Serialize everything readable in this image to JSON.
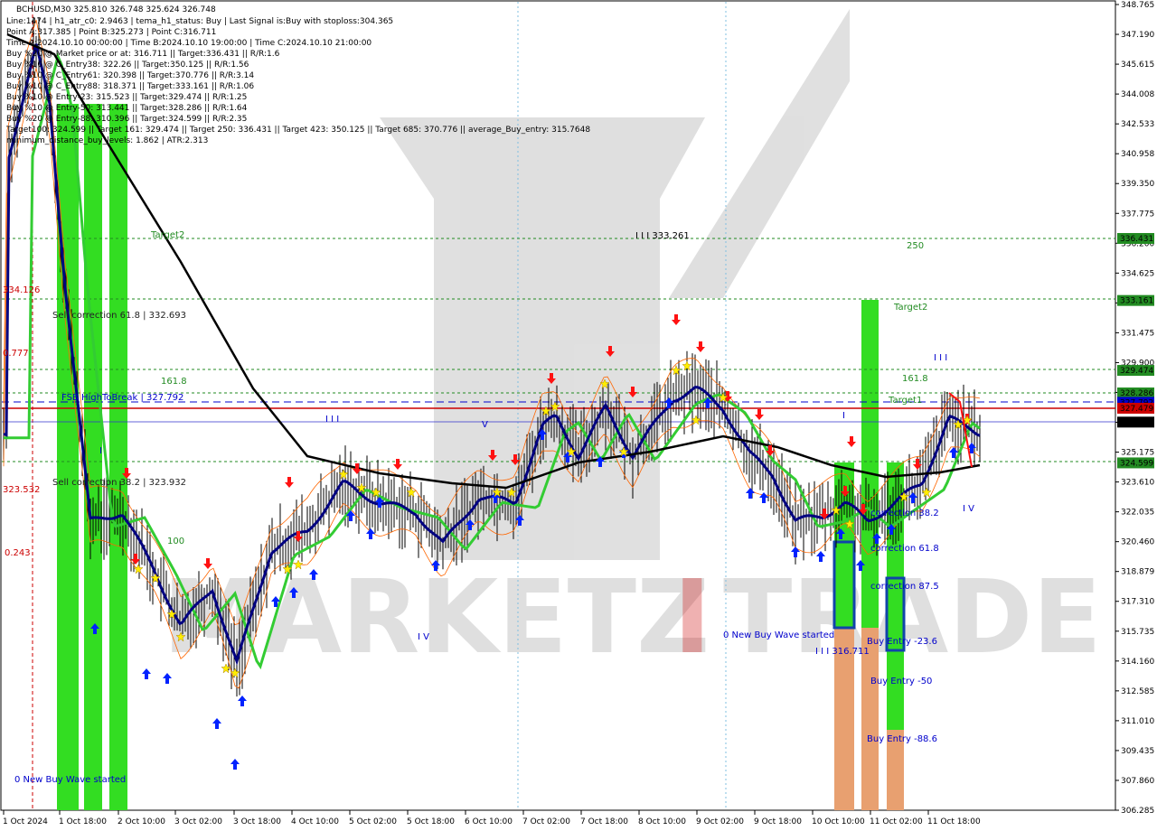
{
  "header": {
    "symbol_line": "BCHUSD,M30  325.810 326.748 325.624 326.748",
    "info_lines": [
      "Line:1474 | h1_atr_c0: 2.9463 | tema_h1_status: Buy | Last Signal is:Buy with stoploss:304.365",
      "Point A:317.385 | Point B:325.273 | Point C:316.711",
      "Time A:2024.10.10 00:00:00 | Time B:2024.10.10 19:00:00 | Time C:2024.10.10 21:00:00",
      "Buy %20 @ Market price or at: 316.711 || Target:336.431 || R/R:1.6",
      "Buy %10 @ C_Entry38: 322.26 || Target:350.125 || R/R:1.56",
      "Buy %10 @ C_Entry61: 320.398 || Target:370.776 || R/R:3.14",
      "Buy %10 @ C_Entry88: 318.371 || Target:333.161 || R/R:1.06",
      "Buy %10 @ Entry-23: 315.523 || Target:329.474 || R/R:1.25",
      "Buy %10 @ Entry-50: 313.441 || Target:328.286 || R/R:1.64",
      "Buy %20 @ Entry-88: 310.396 || Target:324.599 || R/R:2.35",
      "Target100: 324.599 || Target 161: 329.474 || Target 250: 336.431 || Target 423: 350.125 || Target 685: 370.776 || average_Buy_entry: 315.7648",
      "minimum_distance_buy_levels: 1.862 | ATR:2.313"
    ]
  },
  "watermark": {
    "text_dark": "MARKETZ",
    "text_red": "I",
    "text_gray": "TRADE"
  },
  "colors": {
    "candle": "#000000",
    "tema_blue": "#000080",
    "ma_green": "#33cc33",
    "ma_black": "#000000",
    "green_bar": "#33dd22",
    "orange_bar": "#e8a070",
    "level_green": "#228b22",
    "level_blue": "#0000cc",
    "level_red": "#cc0000",
    "arrow_blue": "#0022ff",
    "arrow_red": "#ff1111",
    "star": "#ffee00"
  },
  "price_axis": {
    "ticks": [
      "348.765",
      "347.190",
      "345.615",
      "344.008",
      "342.533",
      "340.958",
      "339.350",
      "337.775",
      "336.200",
      "334.625",
      "333.050",
      "331.475",
      "329.900",
      "328.325",
      "326.750",
      "325.175",
      "323.610",
      "322.035",
      "320.460",
      "318.879",
      "317.310",
      "315.735",
      "314.160",
      "312.585",
      "311.010",
      "309.435",
      "307.860",
      "306.285"
    ],
    "tags": [
      {
        "price": "336.431",
        "color": "#228b22"
      },
      {
        "price": "333.161",
        "color": "#228b22"
      },
      {
        "price": "329.474",
        "color": "#228b22"
      },
      {
        "price": "328.286",
        "color": "#228b22"
      },
      {
        "price": "327.792",
        "color": "#0000cc"
      },
      {
        "price": "327.479",
        "color": "#cc0000"
      },
      {
        "price": "326.748",
        "color": "#000000"
      },
      {
        "price": "324.599",
        "color": "#228b22"
      }
    ]
  },
  "time_axis": [
    "1 Oct 2024",
    "1 Oct 18:00",
    "2 Oct 10:00",
    "3 Oct 02:00",
    "3 Oct 18:00",
    "4 Oct 10:00",
    "5 Oct 02:00",
    "5 Oct 18:00",
    "6 Oct 10:00",
    "7 Oct 02:00",
    "7 Oct 18:00",
    "8 Oct 10:00",
    "9 Oct 02:00",
    "9 Oct 18:00",
    "10 Oct 10:00",
    "11 Oct 02:00",
    "11 Oct 18:00"
  ],
  "annotations": {
    "target2_left": "Target2",
    "level_334": "334.126",
    "sell_corr_618": "Sell correction 61.8 | 332.693",
    "level_0777": "0.777",
    "fib_1618_left": "161.8",
    "fsb_break": "FSB HighToBreak | 327.792",
    "wave_iii_mid": "I I I",
    "wave_v_mid": "V",
    "wave_i_left": "I",
    "sell_corr_382": "Sell correction 38.2 | 323.932",
    "level_323": "323.532",
    "fib_100": "100",
    "level_0243": "0.243",
    "wave_iv_mid": "I V",
    "new_wave_left": "0 New Buy Wave started",
    "peak_333": "I I I 333.261",
    "fib_250": "250",
    "target2_right": "Target2",
    "wave_iii_right": "I I I",
    "fib_1618_right": "161.8",
    "target1": "Target1",
    "wave_i_right": "I",
    "wave_iv_right": "I V",
    "corr_382": "correction 38.2",
    "corr_618": "correction 61.8",
    "corr_875": "correction 87.5",
    "new_wave_right": "0 New Buy Wave started",
    "low_316": "I I I 316.711",
    "buy_entry_23": "Buy Entry -23.6",
    "buy_entry_50": "Buy Entry -50",
    "buy_entry_88": "Buy Entry -88.6"
  },
  "chart_data": {
    "type": "candlestick",
    "symbol": "BCHUSD",
    "timeframe": "M30",
    "ylim": [
      306.285,
      348.765
    ],
    "x_categories": [
      "1 Oct 2024",
      "1 Oct 18:00",
      "2 Oct 10:00",
      "3 Oct 02:00",
      "3 Oct 18:00",
      "4 Oct 10:00",
      "5 Oct 02:00",
      "5 Oct 18:00",
      "6 Oct 10:00",
      "7 Oct 02:00",
      "7 Oct 18:00",
      "8 Oct 10:00",
      "9 Oct 02:00",
      "9 Oct 18:00",
      "10 Oct 10:00",
      "11 Oct 02:00",
      "11 Oct 18:00"
    ],
    "close_path": [
      {
        "x": "1 Oct 2024",
        "y": 341.0
      },
      {
        "x": "1 Oct 18:00",
        "y": 324.0
      },
      {
        "x": "2 Oct 10:00",
        "y": 321.5
      },
      {
        "x": "3 Oct 02:00",
        "y": 315.5
      },
      {
        "x": "3 Oct 18:00",
        "y": 315.0
      },
      {
        "x": "4 Oct 10:00",
        "y": 320.0
      },
      {
        "x": "5 Oct 02:00",
        "y": 322.8
      },
      {
        "x": "5 Oct 18:00",
        "y": 320.5
      },
      {
        "x": "6 Oct 10:00",
        "y": 322.5
      },
      {
        "x": "7 Oct 02:00",
        "y": 326.8
      },
      {
        "x": "7 Oct 18:00",
        "y": 325.0
      },
      {
        "x": "8 Oct 10:00",
        "y": 328.5
      },
      {
        "x": "9 Oct 02:00",
        "y": 327.0
      },
      {
        "x": "9 Oct 18:00",
        "y": 321.0
      },
      {
        "x": "10 Oct 10:00",
        "y": 318.5
      },
      {
        "x": "11 Oct 02:00",
        "y": 322.5
      },
      {
        "x": "11 Oct 18:00",
        "y": 326.7
      }
    ],
    "levels": [
      {
        "name": "Target 250",
        "value": 336.431
      },
      {
        "name": "Target 161",
        "value": 329.474
      },
      {
        "name": "Target 100",
        "value": 324.599
      },
      {
        "name": "C_Entry88 Target",
        "value": 333.161
      },
      {
        "name": "Entry-50 Target",
        "value": 328.286
      },
      {
        "name": "FSB HighToBreak",
        "value": 327.792
      },
      {
        "name": "Stop/resistance",
        "value": 327.479
      },
      {
        "name": "Last price",
        "value": 326.748
      }
    ]
  }
}
